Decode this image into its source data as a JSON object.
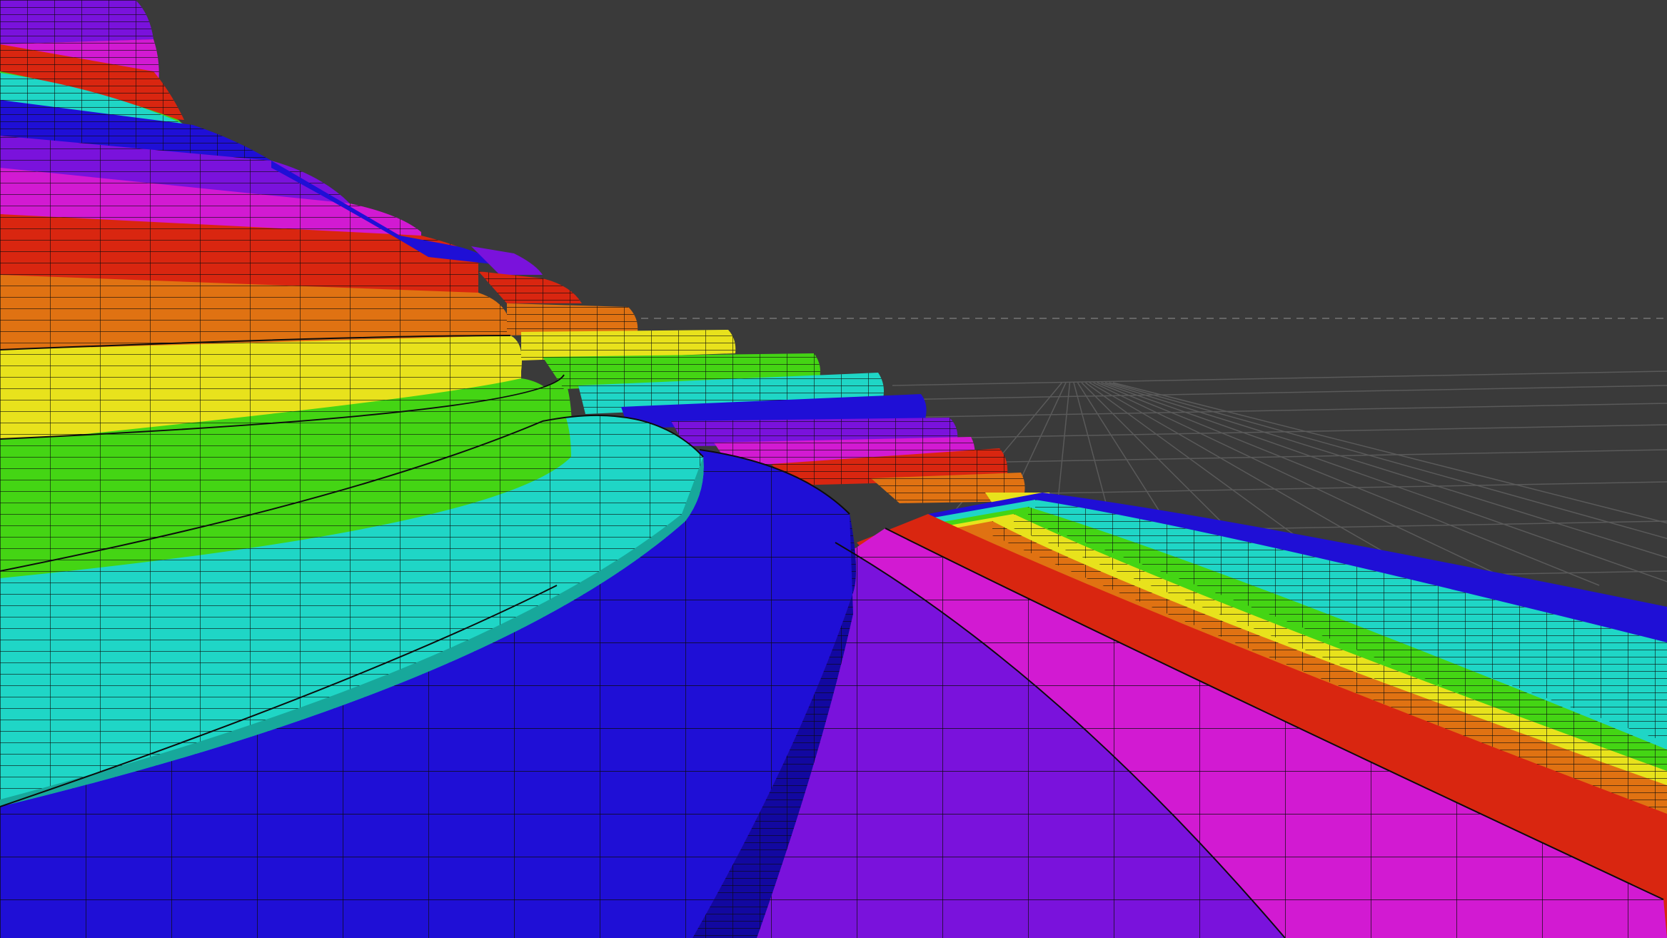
{
  "viewport": {
    "background": "#3a3a3a",
    "grid_color": "#5a5a5a",
    "horizon_color": "#6a6a6a",
    "wireframe_color": "#0c0c0c",
    "grid": true
  },
  "terrace_colors": [
    "#1f0fd6",
    "#7a12dc",
    "#d21ad2",
    "#d92610",
    "#e07212",
    "#e8e21c",
    "#44d514",
    "#1fd6c6"
  ]
}
